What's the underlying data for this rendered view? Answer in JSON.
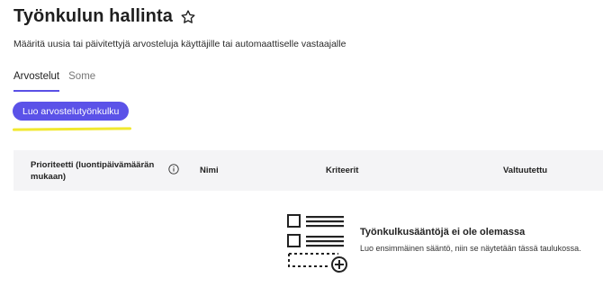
{
  "header": {
    "title": "Työnkulun hallinta",
    "subtitle": "Määritä uusia tai päivitettyjä arvosteluja käyttäjille tai automaattiselle vastaajalle"
  },
  "tabs": [
    {
      "label": "Arvostelut",
      "active": true
    },
    {
      "label": "Some",
      "active": false
    }
  ],
  "actions": {
    "create_label": "Luo arvostelutyönkulku"
  },
  "table": {
    "columns": [
      "Prioriteetti (luontipäivämäärän mukaan)",
      "Nimi",
      "Kriteerit",
      "Valtuutettu"
    ],
    "empty_title": "Työnkulkusääntöjä ei ole olemassa",
    "empty_description": "Luo ensimmäinen sääntö, niin se näytetään tässä taulukossa."
  },
  "colors": {
    "accent": "#5b52e8",
    "highlight": "#f1e82f",
    "header_bg": "#f4f4f6"
  },
  "icons": {
    "favorite": "star-icon",
    "info": "info-icon",
    "empty": "list-add-icon"
  }
}
